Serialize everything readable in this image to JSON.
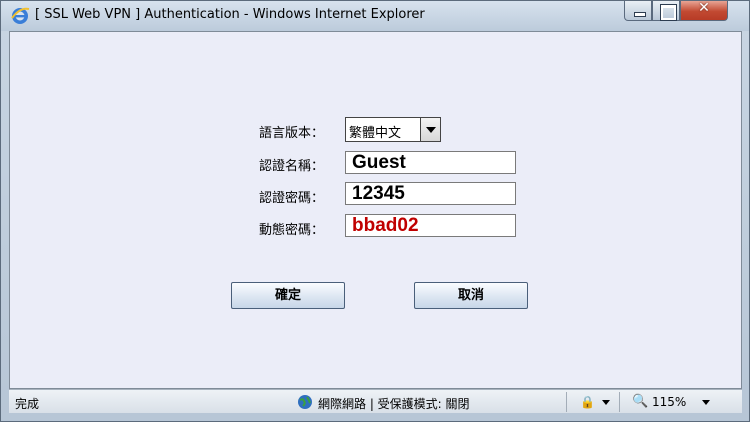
{
  "window": {
    "title": "[ SSL Web VPN ] Authentication - Windows Internet Explorer",
    "close_glyph": "✕"
  },
  "form": {
    "language_label": "語言版本：",
    "language_value": "繁體中文",
    "username_label": "認證名稱：",
    "username_value": "Guest",
    "password_label": "認證密碼：",
    "password_value": "12345",
    "otp_label": "動態密碼：",
    "otp_value": "bbad02",
    "ok_label": "確定",
    "cancel_label": "取消"
  },
  "statusbar": {
    "status_text": "完成",
    "zone_text": "網際網路 | 受保護模式: 關閉",
    "protect_glyph": "🔒",
    "zoom_glyph": "🔍",
    "zoom_text": "115%"
  },
  "colors": {
    "otp_text": "#c00000",
    "content_bg": "#ebedf8"
  },
  "icons": [
    "ie-logo-icon",
    "minimize-icon",
    "maximize-icon",
    "close-icon",
    "dropdown-arrow-icon",
    "globe-icon",
    "protected-mode-icon",
    "zoom-icon"
  ]
}
